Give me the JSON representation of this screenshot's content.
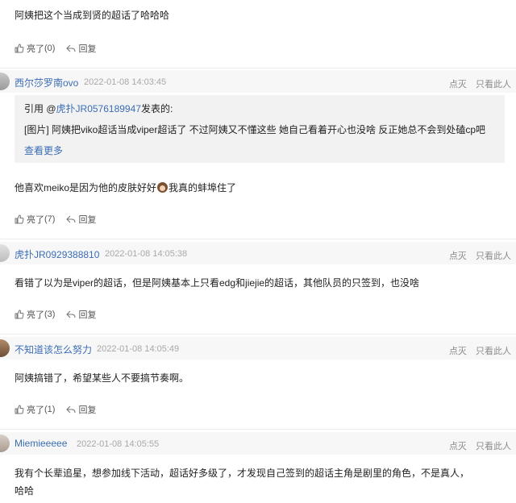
{
  "top_post": {
    "text": "阿姨把这个当成到贤的超话了哈哈哈",
    "like_label": "亮了",
    "like_count": "(0)",
    "reply_label": "回复"
  },
  "posts": [
    {
      "username": "西尔莎罗南ovo",
      "time": "2022-01-08 14:03:45",
      "extinguish": "点灭",
      "only_this": "只看此人",
      "quote_prefix": "引用 @",
      "quote_user": "虎扑JR0576189947",
      "quote_suffix": "发表的:",
      "quote_text": "[图片] 阿姨把viko超话当成viper超话了 不过阿姨又不懂这些 她自己看着开心也没啥 反正她总不会到处磕cp吧",
      "quote_more": "查看更多",
      "text_before": "他喜欢meiko是因为他的皮肤好好",
      "text_after": "我真的蚌埠住了",
      "like_label": "亮了",
      "like_count": "(7)",
      "reply_label": "回复"
    },
    {
      "username": "虎扑JR0929388810",
      "time": "2022-01-08 14:05:38",
      "extinguish": "点灭",
      "only_this": "只看此人",
      "text": "看错了以为是viper的超话，但是阿姨基本上只看edg和jiejie的超话，其他队员的只签到，也没啥",
      "like_label": "亮了",
      "like_count": "(3)",
      "reply_label": "回复"
    },
    {
      "username": "不知道该怎么努力",
      "time": "2022-01-08 14:05:49",
      "extinguish": "点灭",
      "only_this": "只看此人",
      "text": "阿姨搞错了，希望某些人不要搞节奏啊。",
      "like_label": "亮了",
      "like_count": "(1)",
      "reply_label": "回复"
    },
    {
      "username": "Miemieeeee",
      "time": "2022-01-08 14:05:55",
      "extinguish": "点灭",
      "only_this": "只看此人",
      "text": "我有个长辈追星，想参加线下活动，超话好多级了，才发现自己签到的超话主角是剧里的角色，不是真人，哈哈"
    }
  ],
  "colors": {
    "link": "#3b6db6",
    "header_bg": "#f7f7f7",
    "quote_bg": "#f2f2f2",
    "meta": "#a8a8a8"
  }
}
